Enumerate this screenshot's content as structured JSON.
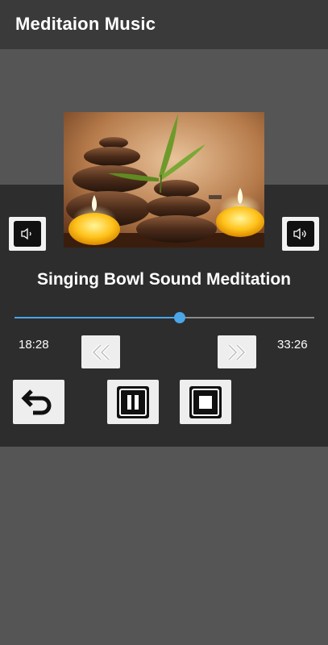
{
  "appbar": {
    "title": "Meditaion Music"
  },
  "track": {
    "title": "Singing Bowl Sound Meditation"
  },
  "progress": {
    "fraction": 0.55
  },
  "times": {
    "elapsed": "18:28",
    "total": "33:26"
  },
  "icons": {
    "volume_down": "volume-down-icon",
    "volume_up": "volume-up-icon",
    "rewind": "rewind-icon",
    "fast_forward": "fast-forward-icon",
    "back": "back-arrow-icon",
    "pause": "pause-icon",
    "stop": "stop-icon"
  },
  "colors": {
    "appbar": "#3a3a3a",
    "background": "#555555",
    "panel": "#2d2d2d",
    "accent": "#4aa6e6"
  }
}
